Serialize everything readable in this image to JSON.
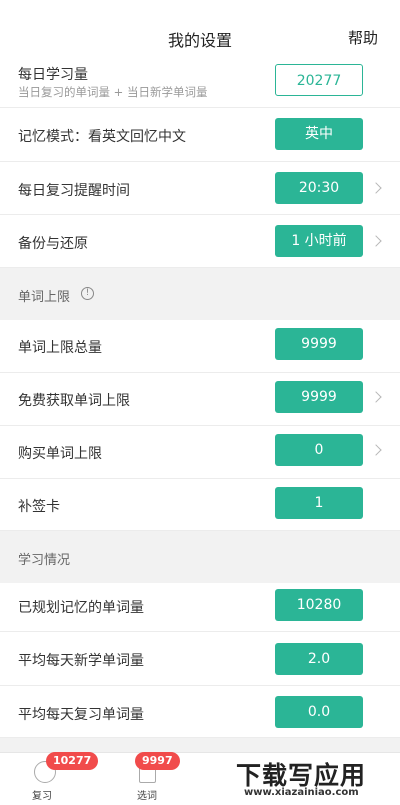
{
  "header": {
    "title": "我的设置",
    "help": "帮助"
  },
  "rows_top": [
    {
      "label": "每日学习量",
      "sub": "当日复习的单词量 + 当日新学单词量",
      "value": "20277"
    },
    {
      "label": "记忆模式：看英文回忆中文",
      "value": "英中"
    },
    {
      "label": "每日复习提醒时间",
      "value": "20:30"
    },
    {
      "label": "备份与还原",
      "value": "1 小时前"
    }
  ],
  "section_limits": {
    "title": "单词上限",
    "info": "!"
  },
  "rows_limits": [
    {
      "label": "单词上限总量",
      "value": "9999"
    },
    {
      "label": "免费获取单词上限",
      "value": "9999"
    },
    {
      "label": "购买单词上限",
      "value": "0"
    },
    {
      "label": "补签卡",
      "value": "1"
    }
  ],
  "section_study": {
    "title": "学习情况"
  },
  "rows_study": [
    {
      "label": "已规划记忆的单词量",
      "value": "10280"
    },
    {
      "label": "平均每天新学单词量",
      "value": "2.0"
    },
    {
      "label": "平均每天复习单词量",
      "value": "0.0"
    }
  ],
  "tabs": [
    {
      "label": "复习",
      "badge": "10277",
      "icon": "review-icon"
    },
    {
      "label": "选词",
      "badge": "9997",
      "icon": "words-icon"
    }
  ],
  "watermark": {
    "main": "下载写应用",
    "url": "www.xiazainiao.com"
  },
  "colors": {
    "accent": "#2bb596",
    "badge": "#f14b4b"
  }
}
